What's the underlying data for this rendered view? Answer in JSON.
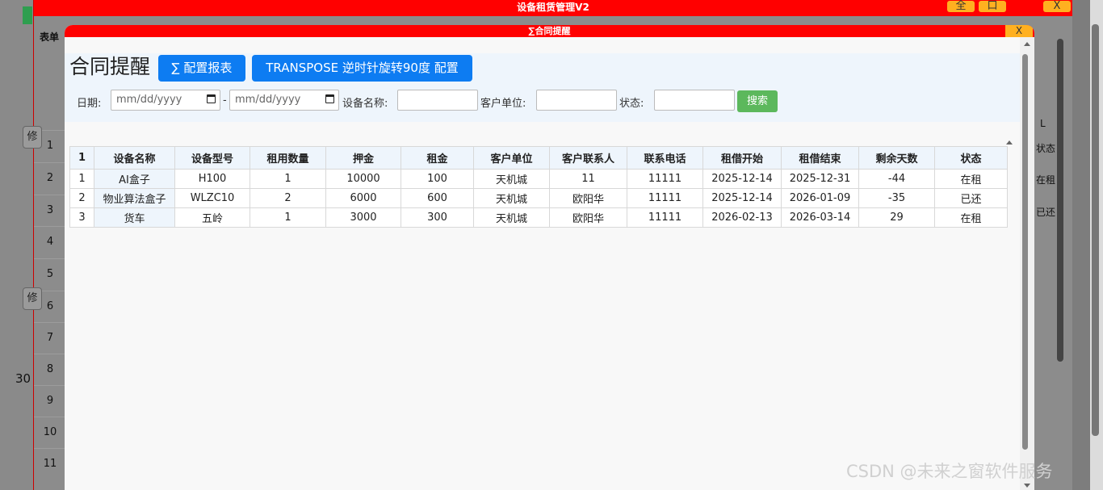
{
  "outer_window": {
    "title": "设备租赁管理V2",
    "btn_full": "全",
    "btn_max": "口",
    "btn_close": "X",
    "form_label": "表单",
    "row_numbers": [
      "1",
      "2",
      "3",
      "4",
      "5",
      "6",
      "7",
      "8",
      "9",
      "10",
      "11"
    ],
    "side_btn": "修",
    "side_value": "30",
    "right_col": [
      "L",
      "状态",
      "在租",
      "已还"
    ]
  },
  "modal": {
    "title": "∑合同提醒",
    "close": "X",
    "page_title": "合同提醒",
    "btn_report": "∑ 配置报表",
    "btn_transpose": "TRANSPOSE 逆时针旋转90度 配置"
  },
  "filters": {
    "date_label": "日期:",
    "date_from_placeholder": "mm/dd/yyyy",
    "date_sep": "-",
    "date_to_placeholder": "mm/dd/yyyy",
    "device_label": "设备名称:",
    "device_value": "",
    "customer_label": "客户单位:",
    "customer_value": "",
    "status_label": "状态:",
    "status_value": "",
    "search_button": "搜索"
  },
  "table": {
    "columns": [
      "1",
      "设备名称",
      "设备型号",
      "租用数量",
      "押金",
      "租金",
      "客户单位",
      "客户联系人",
      "联系电话",
      "租借开始",
      "租借结束",
      "剩余天数",
      "状态"
    ],
    "rows": [
      [
        "1",
        "AI盒子",
        "H100",
        "1",
        "10000",
        "100",
        "天机城",
        "11",
        "11111",
        "2025-12-14",
        "2025-12-31",
        "-44",
        "在租"
      ],
      [
        "2",
        "物业算法盒子",
        "WLZC10",
        "2",
        "6000",
        "600",
        "天机城",
        "欧阳华",
        "11111",
        "2025-12-14",
        "2026-01-09",
        "-35",
        "已还"
      ],
      [
        "3",
        "货车",
        "五岭",
        "1",
        "3000",
        "300",
        "天机城",
        "欧阳华",
        "11111",
        "2026-02-13",
        "2026-03-14",
        "29",
        "在租"
      ]
    ]
  },
  "watermark": "CSDN @未来之窗软件服务"
}
